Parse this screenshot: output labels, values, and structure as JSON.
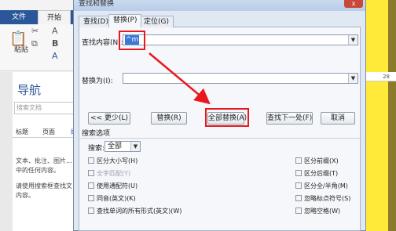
{
  "word": {
    "tabs": [
      "文件",
      "开始"
    ],
    "paste_label": "粘贴",
    "nav_title": "导航",
    "nav_search_placeholder": "搜索文档",
    "nav_tabs": [
      "标题",
      "页面",
      "结果"
    ],
    "nav_text": [
      "文本、批注、图片...",
      "中的任何内容。",
      "请使用搜索框查找文",
      "内容。"
    ],
    "ruler_number": "28"
  },
  "dialog": {
    "title": "查找和替换",
    "close_label": "x",
    "tabs": [
      "查找(D)",
      "替换(P)",
      "定位(G)"
    ],
    "find_label": "查找内容(N):",
    "find_value": "^m",
    "replace_label": "替换为(I):",
    "replace_value": "",
    "buttons": {
      "less": "<< 更少(L)",
      "replace": "替换(R)",
      "replace_all": "全部替换(A)",
      "find_next": "查找下一处(F)",
      "cancel": "取消"
    },
    "search_options_title": "搜索选项",
    "search_direction_label": "搜索:",
    "search_direction_value": "全部",
    "options_left": [
      {
        "label": "区分大小写(H)",
        "disabled": false
      },
      {
        "label": "全字匹配(Y)",
        "disabled": true
      },
      {
        "label": "使用通配符(U)",
        "disabled": false
      },
      {
        "label": "同音(英文)(K)",
        "disabled": false
      },
      {
        "label": "查找单词的所有形式(英文)(W)",
        "disabled": false
      }
    ],
    "options_right": [
      {
        "label": "区分前缀(X)",
        "disabled": false
      },
      {
        "label": "区分后缀(T)",
        "disabled": false
      },
      {
        "label": "区分全/半角(M)",
        "disabled": false
      },
      {
        "label": "忽略标点符号(S)",
        "disabled": false
      },
      {
        "label": "忽略空格(W)",
        "disabled": false
      }
    ]
  },
  "colors": {
    "highlight": "#e8181e",
    "selection": "#3a78d6",
    "ribbon": "#2b579a",
    "document_highlight": "#ffea3a"
  }
}
